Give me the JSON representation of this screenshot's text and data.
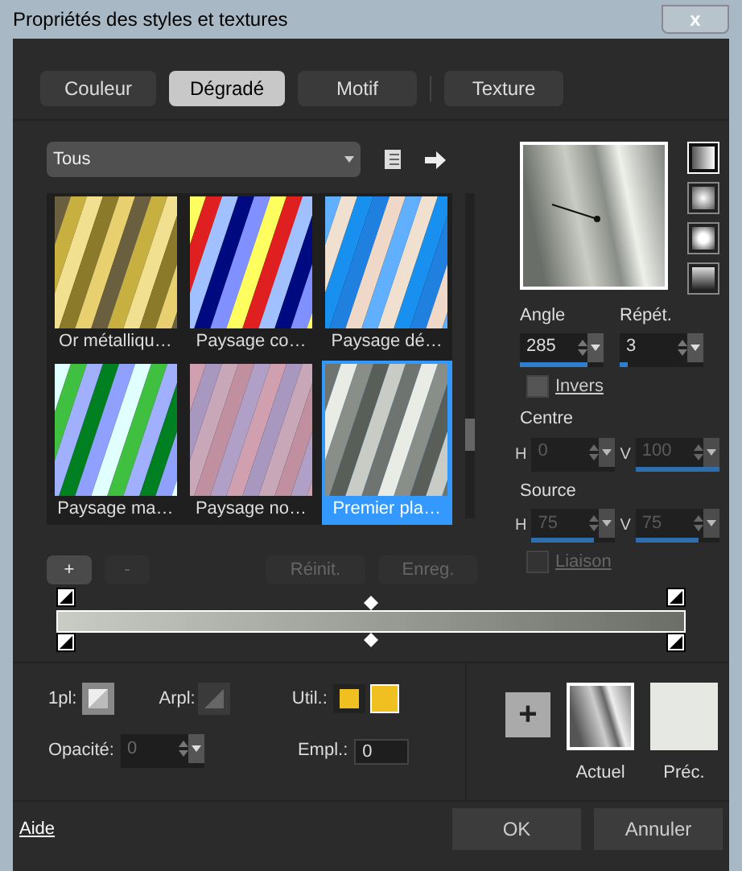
{
  "window": {
    "title": "Propriétés des styles et textures",
    "close": "x"
  },
  "tabs": [
    {
      "label": "Couleur",
      "selected": false
    },
    {
      "label": "Dégradé",
      "selected": true
    },
    {
      "label": "Motif",
      "selected": false
    },
    {
      "label": "Texture",
      "selected": false
    }
  ],
  "category": {
    "value": "Tous"
  },
  "gradients": [
    {
      "name": "Or métalliqu…",
      "selected": false
    },
    {
      "name": "Paysage co…",
      "selected": false
    },
    {
      "name": "Paysage dé…",
      "selected": false
    },
    {
      "name": "Paysage ma…",
      "selected": false
    },
    {
      "name": "Paysage no…",
      "selected": false
    },
    {
      "name": "Premier pla…",
      "selected": true
    }
  ],
  "list_buttons": [
    {
      "label": "+",
      "disabled": false
    },
    {
      "label": "-",
      "disabled": true
    },
    {
      "label": "Réinit.",
      "disabled": true
    },
    {
      "label": "Enreg.",
      "disabled": true
    }
  ],
  "styles": [
    {
      "selected": true
    },
    {
      "selected": false
    },
    {
      "selected": false
    },
    {
      "selected": false
    }
  ],
  "angle": {
    "label": "Angle",
    "value": "285",
    "level": 0.8
  },
  "repeat": {
    "label": "Répét.",
    "value": "3",
    "level": 0.1
  },
  "invert": {
    "label": "Invers",
    "checked": false,
    "disabled": false
  },
  "centre": {
    "label": "Centre",
    "fields": [
      {
        "axis": "H",
        "value": "0",
        "disabled": true
      },
      {
        "axis": "V",
        "value": "100",
        "level": 1,
        "disabled": true
      }
    ]
  },
  "source": {
    "label": "Source",
    "fields": [
      {
        "axis": "H",
        "value": "75",
        "level": 0.75,
        "disabled": true
      },
      {
        "axis": "V",
        "value": "75",
        "level": 0.75,
        "disabled": true
      }
    ]
  },
  "link": {
    "label": "Liaison",
    "checked": false,
    "disabled": true
  },
  "stop_props": {
    "fg_label": "1pl:",
    "bg_label": "Arpl:",
    "user_label": "Util.:",
    "opacity_label": "Opacité:",
    "opacity_value": "0",
    "location_label": "Empl.:",
    "location_value": "0"
  },
  "swatches": {
    "add": "+",
    "current": "Actuel",
    "previous": "Préc."
  },
  "footer": {
    "help": "Aide",
    "ok": "OK",
    "cancel": "Annuler"
  }
}
